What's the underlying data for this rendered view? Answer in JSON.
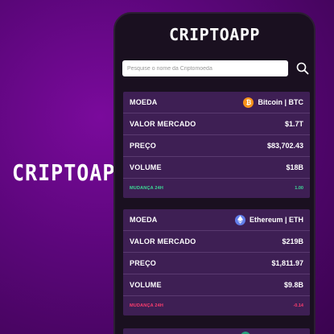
{
  "brand": "CRIPTOAPP",
  "app": {
    "title": "CRIPTOAPP",
    "search_placeholder": "Pesquise o nome da Criptomoeda",
    "search_icon": "magnifier-icon"
  },
  "labels": {
    "coin": "MOEDA",
    "market_value": "VALOR MERCADO",
    "price": "PREÇO",
    "volume": "VOLUME",
    "change_24h": "MUDANÇA 24H"
  },
  "coins": [
    {
      "name": "Bitcoin | BTC",
      "icon": "bitcoin-icon",
      "icon_color": "#f7931a",
      "market_value": "$1.7T",
      "price": "$83,702.43",
      "volume": "$18B",
      "change_24h": "1.00",
      "change_color": "#3ddc97"
    },
    {
      "name": "Ethereum | ETH",
      "icon": "ethereum-icon",
      "icon_color": "#627eea",
      "market_value": "$219B",
      "price": "$1,811.97",
      "volume": "$9.8B",
      "change_24h": "-0.14",
      "change_color": "#ff3d6e"
    }
  ],
  "colors": {
    "background": "#5b067a",
    "phone": "#1a1020",
    "card": "#3e1f54",
    "positive": "#3ddc97",
    "negative": "#ff3d6e"
  }
}
